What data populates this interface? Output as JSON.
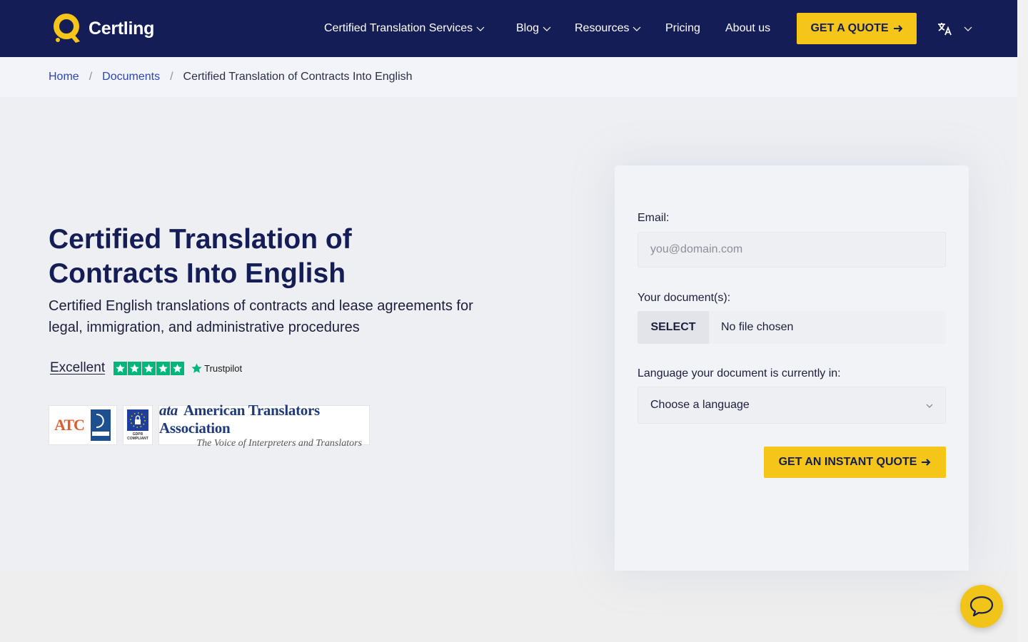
{
  "brand": {
    "name": "Certling",
    "logo_color": "#f5c518",
    "header_bg": "#141d55"
  },
  "nav": {
    "items": [
      {
        "label": "Certified Translation Services",
        "has_dropdown": true
      },
      {
        "label": "Blog",
        "has_dropdown": true
      },
      {
        "label": "Resources",
        "has_dropdown": true
      },
      {
        "label": "Pricing",
        "has_dropdown": false
      },
      {
        "label": "About us",
        "has_dropdown": false
      }
    ],
    "cta_label": "GET A QUOTE",
    "cta_color": "#f5c518",
    "language_icon": "translate-icon"
  },
  "breadcrumb": {
    "items": [
      "Home",
      "Documents"
    ],
    "current": "Certified Translation of Contracts Into English",
    "separator": "/"
  },
  "hero": {
    "title": "Certified Translation of Contracts Into English",
    "subtitle": "Certified English translations of contracts and lease agreements for legal, immigration, and administrative procedures",
    "rating_word": "Excellent",
    "rating_stars": 5,
    "rating_provider": "Trustpilot",
    "badges": {
      "atc_label": "ATC",
      "gdpr_label": "GDPR COMPLIANT",
      "ata_abbr": "ata",
      "ata_name": "American Translators Association",
      "ata_tagline": "The Voice of Interpreters and Translators"
    }
  },
  "form": {
    "email_label": "Email:",
    "email_placeholder": "you@domain.com",
    "email_value": "",
    "documents_label": "Your document(s):",
    "select_button": "SELECT",
    "file_status": "No file chosen",
    "language_label": "Language your document is currently in:",
    "language_value": "Choose a language",
    "submit_label": "GET AN INSTANT QUOTE",
    "accent_color": "#f5c518"
  },
  "chat": {
    "icon": "chat-bubble-icon",
    "color": "#f0c419"
  }
}
